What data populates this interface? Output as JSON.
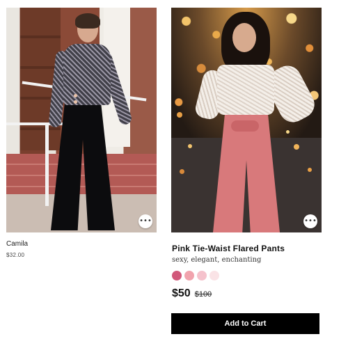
{
  "products": [
    {
      "name": "Camila",
      "price": "$32.00",
      "more_icon": "more-horizontal-icon"
    },
    {
      "name": "Pink Tie-Waist Flared Pants",
      "tagline": "sexy, elegant, enchanting",
      "price": "$50",
      "compare_price": "$100",
      "swatches": [
        "#d1587a",
        "#f1a3ad",
        "#f5c2cc",
        "#fae3e6"
      ],
      "add_to_cart_label": "Add to Cart",
      "more_icon": "more-horizontal-icon"
    }
  ]
}
